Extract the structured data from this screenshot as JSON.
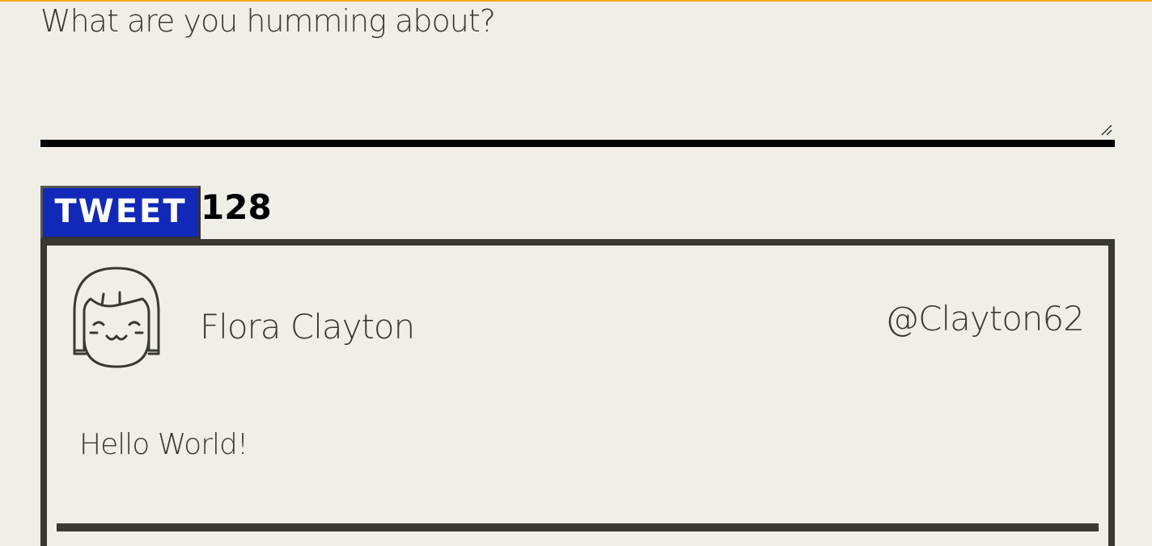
{
  "composer": {
    "placeholder": "What are you humming about?",
    "value": ""
  },
  "actions": {
    "tweet_label": "TWEET",
    "remaining_chars": "128"
  },
  "tweets": [
    {
      "name": "Flora Clayton",
      "handle": "@Clayton62",
      "body": "Hello World!",
      "avatar_icon": "girl-face-icon"
    }
  ],
  "colors": {
    "background": "#f1eee8",
    "tweet_button": "#1228b8",
    "text": "#3a3833",
    "accent": "#f5a623"
  }
}
